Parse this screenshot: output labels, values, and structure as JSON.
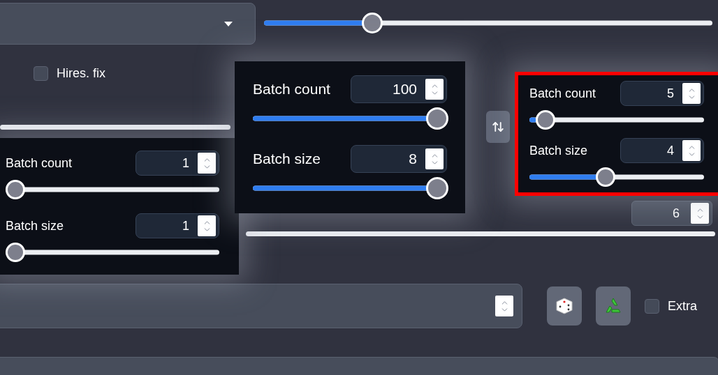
{
  "top_slider": {
    "level": 0.23
  },
  "hires_fix": {
    "label": "Hires. fix",
    "checked": false
  },
  "size_field": {
    "value": "6"
  },
  "extra": {
    "label": "Extra",
    "checked": false
  },
  "panels": [
    {
      "kind": "plain",
      "sliders": [
        {
          "label": "Batch count",
          "value": "1",
          "level": 0
        },
        {
          "label": "Batch size",
          "value": "1",
          "level": 0
        }
      ]
    },
    {
      "kind": "plain",
      "sliders": [
        {
          "label": "Batch count",
          "value": "100",
          "level": 1
        },
        {
          "label": "Batch size",
          "value": "8",
          "level": 1
        }
      ]
    },
    {
      "kind": "highlighted",
      "sliders": [
        {
          "label": "Batch count",
          "value": "5",
          "level": 0.04
        },
        {
          "label": "Batch size",
          "value": "4",
          "level": 0.43
        }
      ]
    }
  ]
}
